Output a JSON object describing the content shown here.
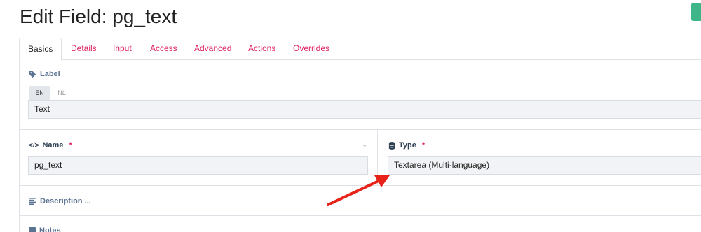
{
  "header": {
    "title": "Edit Field: pg_text"
  },
  "tabs": [
    {
      "label": "Basics"
    },
    {
      "label": "Details"
    },
    {
      "label": "Input"
    },
    {
      "label": "Access"
    },
    {
      "label": "Advanced"
    },
    {
      "label": "Actions"
    },
    {
      "label": "Overrides"
    }
  ],
  "label_section": {
    "title": "Label",
    "languages": [
      "EN",
      "NL"
    ],
    "value": "Text"
  },
  "name_section": {
    "title": "Name",
    "required_mark": "*",
    "value": "pg_text"
  },
  "type_section": {
    "title": "Type",
    "required_mark": "*",
    "value": "Textarea (Multi-language)"
  },
  "description_section": {
    "title": "Description ..."
  },
  "notes_section": {
    "title": "Notes"
  },
  "colors": {
    "accent": "#e0245e",
    "label": "#5b7290",
    "arrow": "#e8231a",
    "save": "#3fb58a"
  }
}
